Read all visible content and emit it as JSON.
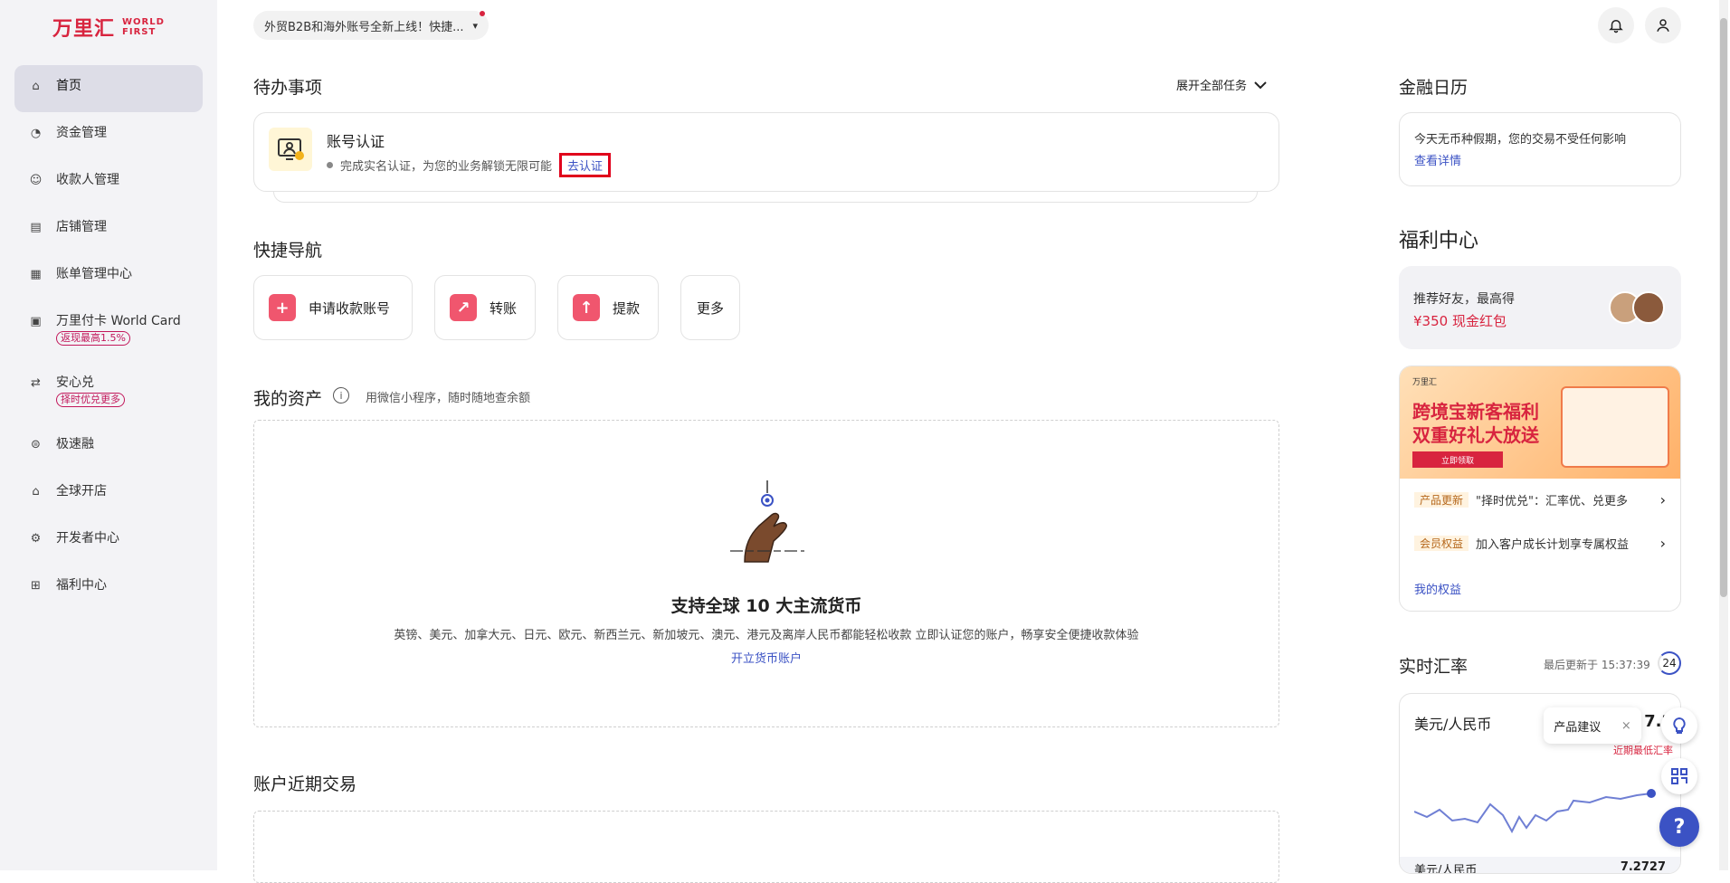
{
  "brand": {
    "cn": "万里汇",
    "en_line1": "WORLD",
    "en_line2": "FIRST",
    "color": "#d8243f"
  },
  "sidebar": {
    "items": [
      {
        "label": "首页",
        "icon": "home-icon",
        "glyph": "⌂"
      },
      {
        "label": "资金管理",
        "icon": "fund-icon",
        "glyph": "◔"
      },
      {
        "label": "收款人管理",
        "icon": "person-icon",
        "glyph": "☺"
      },
      {
        "label": "店铺管理",
        "icon": "store-icon",
        "glyph": "▤"
      },
      {
        "label": "账单管理中心",
        "icon": "bill-icon",
        "glyph": "▦"
      },
      {
        "label": "万里付卡 World Card",
        "icon": "card-icon",
        "glyph": "▣",
        "badge": "返现最高1.5%"
      },
      {
        "label": "安心兑",
        "icon": "exchange-icon",
        "glyph": "⇄",
        "badge": "择时优兑更多"
      },
      {
        "label": "极速融",
        "icon": "finance-icon",
        "glyph": "⊜"
      },
      {
        "label": "全球开店",
        "icon": "shop-icon",
        "glyph": "⌂"
      },
      {
        "label": "开发者中心",
        "icon": "dev-icon",
        "glyph": "⚙"
      },
      {
        "label": "福利中心",
        "icon": "gift-icon",
        "glyph": "⊞"
      }
    ]
  },
  "announcement": {
    "text": "外贸B2B和海外账号全新上线！快捷...",
    "chevron": "▾"
  },
  "todo": {
    "title": "待办事项",
    "expand_label": "展开全部任务",
    "task_title": "账号认证",
    "task_desc": "完成实名认证，为您的业务解锁无限可能",
    "task_action": "去认证"
  },
  "quick_nav": {
    "title": "快捷导航",
    "buttons": [
      {
        "label": "申请收款账号",
        "glyph": "+"
      },
      {
        "label": "转账",
        "glyph": "↗"
      },
      {
        "label": "提款",
        "glyph": "↑"
      },
      {
        "label": "更多"
      }
    ]
  },
  "assets": {
    "title": "我的资产",
    "hint": "用微信小程序，随时随地查余额",
    "empty_title": "支持全球 10 大主流货币",
    "empty_desc": "英镑、美元、加拿大元、日元、欧元、新西兰元、新加坡元、澳元、港元及离岸人民币都能轻松收款 立即认证您的账户，畅享安全便捷收款体验",
    "empty_link": "开立货币账户"
  },
  "recent": {
    "title": "账户近期交易"
  },
  "calendar": {
    "title": "金融日历",
    "text": "今天无币种假期，您的交易不受任何影响",
    "link": "查看详情"
  },
  "welfare": {
    "title": "福利中心",
    "referral_line1": "推荐好友，最高得",
    "referral_line2": "¥350 现金红包",
    "banner_line1": "跨境宝新客福利",
    "banner_line2": "双重好礼大放送",
    "banner_btn": "立即领取",
    "banner_brand": "万里汇",
    "news": [
      {
        "tag": "产品更新",
        "text": "\"择时优兑\"：汇率优、兑更多"
      },
      {
        "tag": "会员权益",
        "text": "加入客户成长计划享专属权益"
      }
    ],
    "link": "我的权益"
  },
  "rates": {
    "title": "实时汇率",
    "updated": "最后更新于 15:37:39",
    "countdown": "24",
    "pair": "美元/人民币",
    "value_partial": "7.2",
    "low_note": "近期最低汇率",
    "footer_pair": "美元/人民币",
    "footer_value": "7.2727"
  },
  "floating": {
    "suggestion": "产品建议",
    "close": "×",
    "help": "?"
  },
  "colors": {
    "accent": "#3b52c4",
    "brand": "#d8243f",
    "highlight_border": "#e0001b"
  }
}
